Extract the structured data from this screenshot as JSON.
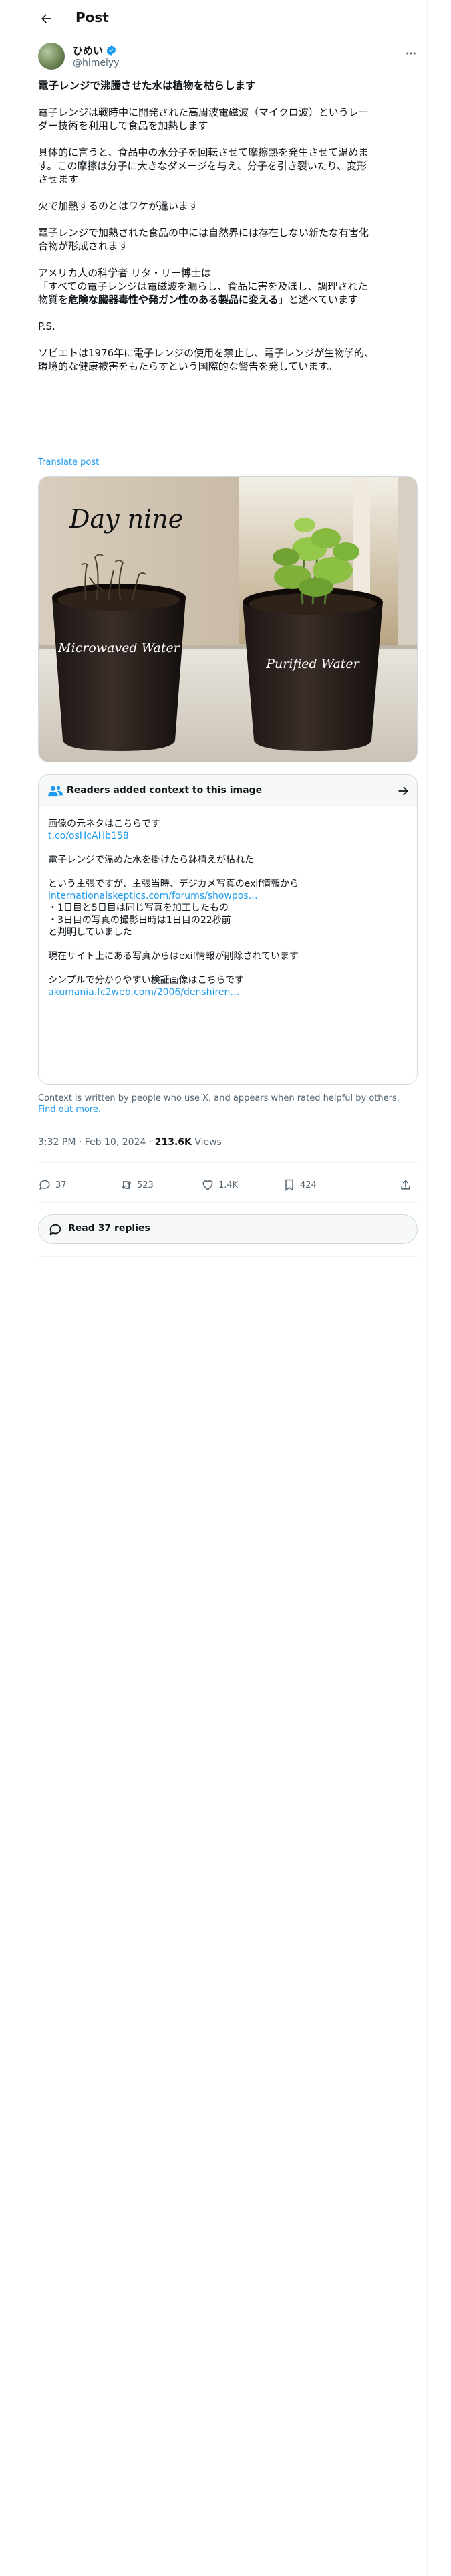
{
  "header": {
    "title": "Post"
  },
  "author": {
    "name": "ひめい",
    "handle": "@himeiyy"
  },
  "tweet": {
    "title": "電子レンジで沸騰させた水は植物を枯らします",
    "lines": [
      "電子レンジは戦時中に開発された高周波電磁波（マイクロ波）というレー",
      "ダー技術を利用して食品を加熱します",
      "具体的に言うと、食品中の水分子を回転させて摩擦熱を発生させて温めま",
      "す。この摩擦は分子に大きなダメージを与え、分子を引き裂いたり、変形",
      "させます",
      "火で加熱するのとはワケが違います",
      "電子レンジで加熱された食品の中には自然界には存在しない新たな有害化",
      "合物が形成されます",
      "アメリカ人の科学者 リタ・リー博士は",
      "「すべての電子レンジは電磁波を漏らし、食品に害を及ぼし、調理された",
      "物質を",
      "危険な臓器毒性や発ガン性のある製品に変える",
      "」と述べています",
      "P.S.",
      "ソビエトは1976年に電子レンジの使用を禁止し、電子レンジが生物学的、",
      "環境的な健康被害をもたらすという国際的な警告を発しています。"
    ],
    "translate_label": "Translate post"
  },
  "photo": {
    "handwritten": "Day nine",
    "left_pot_label": "Microwaved Water",
    "right_pot_label": "Purified Water"
  },
  "note": {
    "header": "Readers added context to this image",
    "lines": [
      "画像の元ネタはこちらです",
      "t.co/osHcAHb158",
      "電子レンジで温めた水を掛けたら鉢植えが枯れた",
      "という主張ですが、主張当時、デジカメ写真のexif情報から",
      "internationalskeptics.com/forums/showpos…",
      "・1日目と5日目は同じ写真を加工したもの",
      "・3日目の写真の撮影日時は1日目の22秒前",
      "と判明していました",
      "現在サイト上にある写真からはexif情報が削除されています",
      "シンプルで分かりやすい検証画像はこちらです",
      "akumania.fc2web.com/2006/denshiren…"
    ]
  },
  "disclaimer": {
    "text": "Context is written by people who use X, and appears when rated helpful by others. ",
    "link": "Find out more."
  },
  "meta": {
    "time": "3:32 PM",
    "sep": " · ",
    "date": "Feb 10, 2024",
    "dot": " · ",
    "views": "213.6K",
    "views_label": " Views"
  },
  "actions": {
    "replies": "37",
    "reposts": "523",
    "likes": "1.4K",
    "bookmarks": "424"
  },
  "read_replies": {
    "label": "Read 37 replies"
  },
  "colors": {
    "accent": "#1d9bf0",
    "text": "#0f1419",
    "secondary": "#536471",
    "border": "#cfd9de"
  }
}
